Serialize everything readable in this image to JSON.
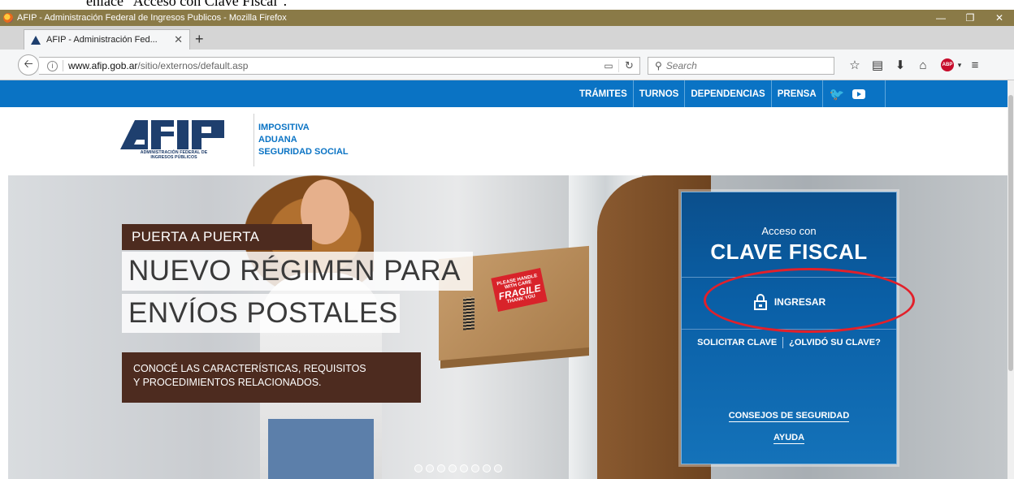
{
  "doc_caption": "enlace \"Acceso con Clave Fiscal\".",
  "window": {
    "title": "AFIP - Administración Federal de Ingresos Publicos - Mozilla Firefox",
    "controls": {
      "minimize": "—",
      "restore": "❐",
      "close": "✕"
    }
  },
  "tabs": [
    {
      "label": "AFIP - Administración Fed...",
      "close": "✕"
    }
  ],
  "new_tab": "+",
  "navbar": {
    "url_host": "www.afip.gob.ar",
    "url_path": "/sitio/externos/default.asp",
    "search_placeholder": "Search",
    "icons": [
      "back-icon",
      "info-icon",
      "reader-icon",
      "reload-icon",
      "search-icon",
      "bookmark-star-icon",
      "bookmarks-menu-icon",
      "download-icon",
      "home-icon",
      "adblock-icon",
      "menu-icon"
    ]
  },
  "site_menu": {
    "items": [
      "TRÁMITES",
      "TURNOS",
      "DEPENDENCIAS",
      "PRENSA"
    ]
  },
  "logo": {
    "caption_line1": "ADMINISTRACIÓN FEDERAL DE",
    "caption_line2": "INGRESOS PÚBLICOS",
    "brand_color": "#1e3f6e"
  },
  "header_links": [
    "IMPOSITIVA",
    "ADUANA",
    "SEGURIDAD SOCIAL"
  ],
  "promo": {
    "kicker": "PUERTA A PUERTA",
    "headline_line1": "NUEVO RÉGIMEN PARA",
    "headline_line2": "ENVÍOS POSTALES",
    "cta_line1": "CONOCÉ LAS CARACTERÍSTICAS, REQUISITOS",
    "cta_line2": "Y PROCEDIMIENTOS RELACIONADOS.",
    "package_label_small": "PLEASE HANDLE WITH CARE",
    "package_label_big": "FRAGILE",
    "package_label_footer": "THANK YOU"
  },
  "carousel": {
    "dot_count": 8
  },
  "login": {
    "label_small": "Acceso con",
    "label_big": "CLAVE FISCAL",
    "login_button": "INGRESAR",
    "request_key": "SOLICITAR CLAVE",
    "forgot_key": "¿OLVIDÓ SU CLAVE?",
    "security_tips": "CONSEJOS DE SEGURIDAD",
    "help": "AYUDA",
    "highlight_color": "#e2202a"
  },
  "colors": {
    "site_blue": "#0a73c4",
    "promo_brown": "#4d2b1f",
    "titlebar": "#8a7a47"
  }
}
